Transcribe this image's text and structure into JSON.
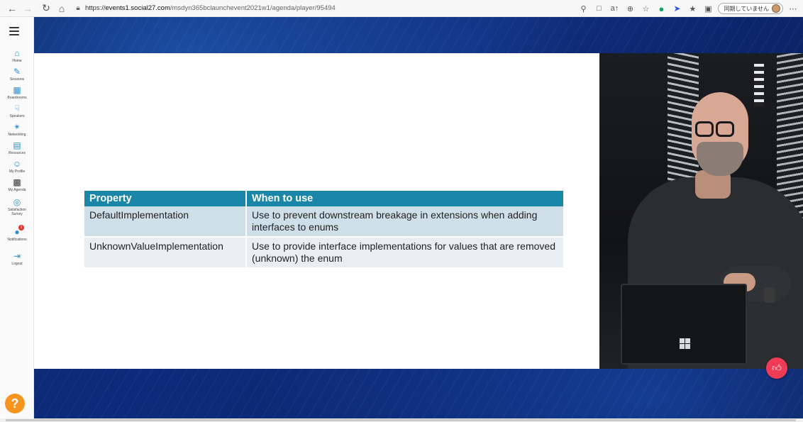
{
  "browser": {
    "url_prefix": "https://",
    "url_host": "events1.social27.com",
    "url_path": "/msdyn365bclaunchevent2021w1/agenda/player/95494",
    "sync_label": "同期していません",
    "icons": {
      "back": "back-arrow-icon",
      "forward": "forward-arrow-icon",
      "refresh": "refresh-icon",
      "home": "home-icon",
      "lock": "lock-icon"
    }
  },
  "sidebar": {
    "items": [
      {
        "label": "Home",
        "icon": "home-icon"
      },
      {
        "label": "Sessions",
        "icon": "pen-icon"
      },
      {
        "label": "Boardrooms",
        "icon": "boardroom-icon"
      },
      {
        "label": "Speakers",
        "icon": "speaker-icon"
      },
      {
        "label": "Networking",
        "icon": "networking-icon"
      },
      {
        "label": "Resources",
        "icon": "resources-icon"
      },
      {
        "label": "My Profile",
        "icon": "profile-icon"
      },
      {
        "label": "My Agenda",
        "icon": "agenda-icon"
      },
      {
        "label": "Satisfaction Survey",
        "icon": "survey-icon"
      },
      {
        "label": "Notifications",
        "icon": "bell-icon",
        "badge": "1"
      },
      {
        "label": "Logout",
        "icon": "logout-icon"
      }
    ],
    "help_label": "?"
  },
  "slide": {
    "headers": [
      "Property",
      "When to use"
    ],
    "rows": [
      [
        "DefaultImplementation",
        "Use to prevent downstream breakage in extensions when adding interfaces to enums"
      ],
      [
        "UnknownValueImplementation",
        "Use to provide interface implementations for values that are removed (unknown) the enum"
      ]
    ]
  },
  "colors": {
    "table_header": "#1a87a8",
    "row_1": "#cfdfe8",
    "row_2": "#e7eff4",
    "like_button": "#ef3b55",
    "help_button": "#f7941e",
    "sidebar_icon": "#2e8fc7"
  }
}
